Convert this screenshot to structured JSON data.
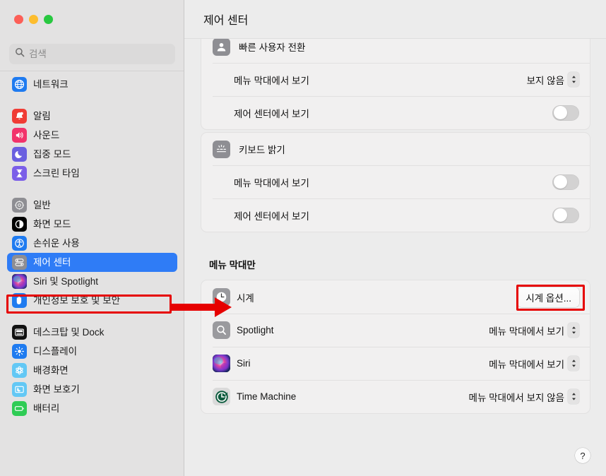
{
  "window": {
    "traffic_lights": [
      "close",
      "minimize",
      "maximize"
    ],
    "colors": {
      "close": "#fc5f57",
      "minimize": "#fdbd2e",
      "maximize": "#28c840",
      "selection": "#2f7cf6",
      "annotation": "#e60000"
    }
  },
  "sidebar": {
    "search": {
      "value": "",
      "placeholder": "검색"
    },
    "groups": [
      {
        "items": [
          {
            "label": "네트워크",
            "icon": "globe-icon",
            "selected": false
          }
        ]
      },
      {
        "items": [
          {
            "label": "알림",
            "icon": "bell-icon",
            "selected": false
          },
          {
            "label": "사운드",
            "icon": "speaker-icon",
            "selected": false
          },
          {
            "label": "집중 모드",
            "icon": "moon-icon",
            "selected": false
          },
          {
            "label": "스크린 타임",
            "icon": "hourglass-icon",
            "selected": false
          }
        ]
      },
      {
        "items": [
          {
            "label": "일반",
            "icon": "gear-icon",
            "selected": false
          },
          {
            "label": "화면 모드",
            "icon": "appearance-icon",
            "selected": false
          },
          {
            "label": "손쉬운 사용",
            "icon": "accessibility-icon",
            "selected": false
          },
          {
            "label": "제어 센터",
            "icon": "control-center-icon",
            "selected": true
          },
          {
            "label": "Siri 및 Spotlight",
            "icon": "siri-icon",
            "selected": false
          },
          {
            "label": "개인정보 보호 및 보안",
            "icon": "hand-icon",
            "selected": false
          }
        ]
      },
      {
        "items": [
          {
            "label": "데스크탑 및 Dock",
            "icon": "desktop-dock-icon",
            "selected": false
          },
          {
            "label": "디스플레이",
            "icon": "display-icon",
            "selected": false
          },
          {
            "label": "배경화면",
            "icon": "wallpaper-icon",
            "selected": false
          },
          {
            "label": "화면 보호기",
            "icon": "screensaver-icon",
            "selected": false
          },
          {
            "label": "배터리",
            "icon": "battery-icon",
            "selected": false
          }
        ]
      }
    ]
  },
  "content": {
    "title": "제어 센터",
    "help_label": "?",
    "cards": [
      {
        "name": "fast-user-switching-card",
        "header": {
          "label": "빠른 사용자 전환",
          "icon": "fast-user-switching-icon"
        },
        "rows": [
          {
            "label": "메뉴 막대에서 보기",
            "control": "popup",
            "value": "보지 않음"
          },
          {
            "label": "제어 센터에서 보기",
            "control": "switch",
            "value": "off"
          }
        ]
      },
      {
        "name": "keyboard-brightness-card",
        "header": {
          "label": "키보드 밝기",
          "icon": "keyboard-brightness-icon"
        },
        "rows": [
          {
            "label": "메뉴 막대에서 보기",
            "control": "switch",
            "value": "off"
          },
          {
            "label": "제어 센터에서 보기",
            "control": "switch",
            "value": "off"
          }
        ]
      }
    ],
    "menu_bar_only": {
      "section_title": "메뉴 막대만",
      "rows": [
        {
          "label": "시계",
          "icon": "clock-icon",
          "control": "button",
          "value": "시계 옵션..."
        },
        {
          "label": "Spotlight",
          "icon": "spotlight-icon",
          "control": "popup",
          "value": "메뉴 막대에서 보기"
        },
        {
          "label": "Siri",
          "icon": "siri-icon",
          "control": "popup",
          "value": "메뉴 막대에서 보기"
        },
        {
          "label": "Time Machine",
          "icon": "time-machine-icon",
          "control": "popup",
          "value": "메뉴 막대에서 보지 않음"
        }
      ]
    }
  },
  "annotations": [
    {
      "name": "highlight-control-center-sidebar-item",
      "shape": "rectangle",
      "color": "#e60000"
    },
    {
      "name": "pointer-arrow-to-clock-row",
      "shape": "arrow",
      "color": "#e60000"
    },
    {
      "name": "highlight-clock-options-button",
      "shape": "rectangle",
      "color": "#e60000"
    }
  ]
}
